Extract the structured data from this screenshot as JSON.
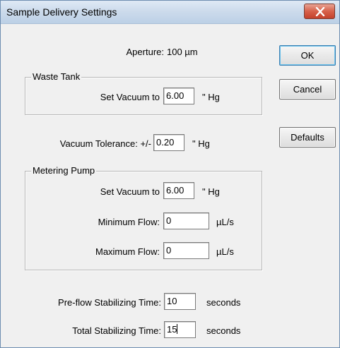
{
  "window": {
    "title": "Sample Delivery Settings"
  },
  "aperture": {
    "label": "Aperture:",
    "value": "100 µm"
  },
  "waste_tank": {
    "group_label": "Waste Tank",
    "vacuum_label": "Set Vacuum to",
    "vacuum_value": "6.00",
    "vacuum_unit": "\" Hg"
  },
  "vacuum_tolerance": {
    "label": "Vacuum Tolerance: +/-",
    "value": "0.20",
    "unit": "\" Hg"
  },
  "metering_pump": {
    "group_label": "Metering Pump",
    "vacuum_label": "Set Vacuum to",
    "vacuum_value": "6.00",
    "vacuum_unit": "\" Hg",
    "min_flow_label": "Minimum Flow:",
    "min_flow_value": "0",
    "min_flow_unit": "µL/s",
    "max_flow_label": "Maximum Flow:",
    "max_flow_value": "0",
    "max_flow_unit": "µL/s"
  },
  "preflow": {
    "label": "Pre-flow Stabilizing Time:",
    "value": "10",
    "unit": "seconds"
  },
  "total_stab": {
    "label": "Total Stabilizing Time:",
    "value": "15",
    "unit": "seconds"
  },
  "buttons": {
    "ok": "OK",
    "cancel": "Cancel",
    "defaults": "Defaults"
  },
  "icons": {
    "close": "close-icon"
  },
  "colors": {
    "close_button": "#c4412b",
    "titlebar": "#cbdaeb",
    "dialog_bg": "#f0f0f0"
  }
}
